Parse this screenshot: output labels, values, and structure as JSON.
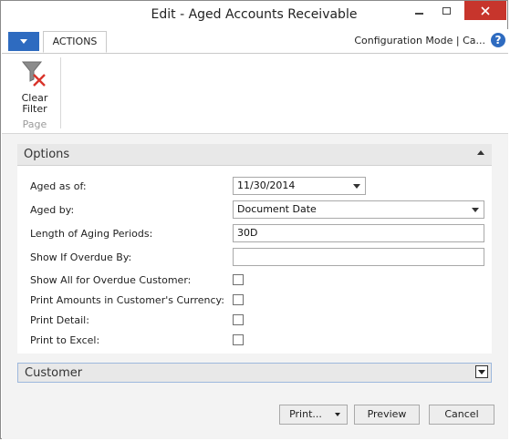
{
  "window": {
    "title": "Edit - Aged Accounts Receivable",
    "close_color": "#c7352c"
  },
  "ribbon": {
    "tab_actions": "ACTIONS",
    "config_mode": "Configuration Mode | Ca...",
    "help_glyph": "?",
    "clear_filter_line1": "Clear",
    "clear_filter_line2": "Filter",
    "group_label": "Page",
    "accent_color": "#2e6bc0"
  },
  "options": {
    "title": "Options",
    "fields": {
      "aged_as_of": {
        "label": "Aged as of:",
        "value": "11/30/2014"
      },
      "aged_by": {
        "label": "Aged by:",
        "value": "Document Date"
      },
      "length_of_aging_periods": {
        "label": "Length of Aging Periods:",
        "value": "30D"
      },
      "show_if_overdue_by": {
        "label": "Show If Overdue By:",
        "value": ""
      },
      "show_all_for_overdue_customer": {
        "label": "Show All for Overdue Customer:",
        "checked": false
      },
      "print_amounts_in_customer_currency": {
        "label": "Print Amounts in Customer's Currency:",
        "checked": false
      },
      "print_detail": {
        "label": "Print Detail:",
        "checked": false
      },
      "print_to_excel": {
        "label": "Print to Excel:",
        "checked": false
      }
    }
  },
  "customer": {
    "title": "Customer"
  },
  "buttons": {
    "print": "Print...",
    "preview": "Preview",
    "cancel": "Cancel"
  }
}
